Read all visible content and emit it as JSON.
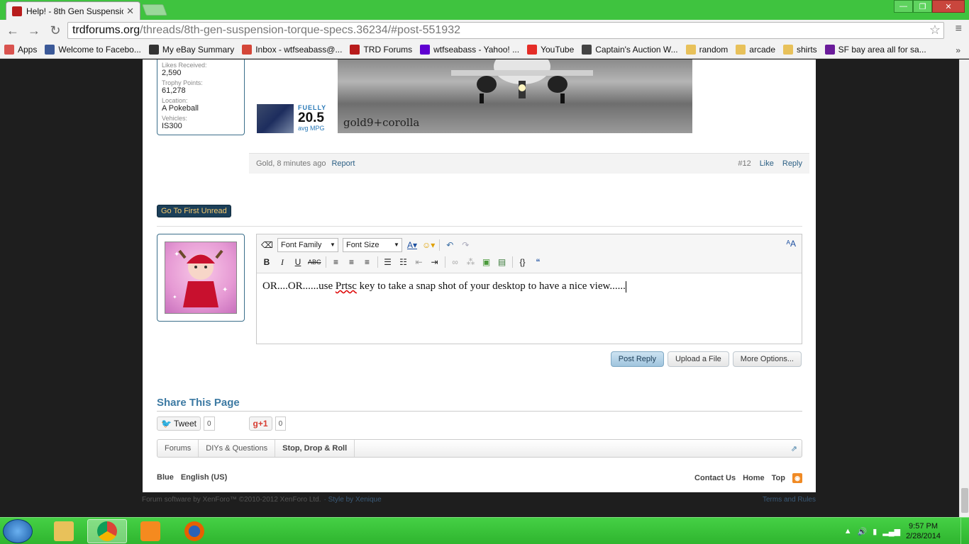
{
  "browser": {
    "tab_title": "Help! - 8th Gen Suspensio",
    "url_host": "trdforums.org",
    "url_path": "/threads/8th-gen-suspension-torque-specs.36234/#post-551932",
    "bookmarks": [
      {
        "label": "Apps",
        "color": "#d9534f"
      },
      {
        "label": "Welcome to Facebo...",
        "color": "#3b5998"
      },
      {
        "label": "My eBay Summary",
        "color": "#333333"
      },
      {
        "label": "Inbox - wtfseabass@...",
        "color": "#d44638"
      },
      {
        "label": "TRD Forums",
        "color": "#b81c1c"
      },
      {
        "label": "wtfseabass - Yahoo! ...",
        "color": "#5f01d1"
      },
      {
        "label": "YouTube",
        "color": "#e52d27"
      },
      {
        "label": "Captain's Auction W...",
        "color": "#444444"
      },
      {
        "label": "random",
        "color": "#e8c15a"
      },
      {
        "label": "arcade",
        "color": "#e8c15a"
      },
      {
        "label": "shirts",
        "color": "#e8c15a"
      },
      {
        "label": "SF bay area all for sa...",
        "color": "#6a1b9a"
      }
    ],
    "bookmarks_more": "»"
  },
  "post": {
    "stats": [
      {
        "label": "Likes Received:",
        "value": "2,590"
      },
      {
        "label": "Trophy Points:",
        "value": "61,278"
      },
      {
        "label": "Location:",
        "value": "A Pokeball"
      },
      {
        "label": "Vehicles:",
        "value": "IS300"
      }
    ],
    "fuelly": {
      "brand": "FUELLY",
      "mpg": "20.5",
      "unit": "avg MPG"
    },
    "signature_caption": "gold9+corolla",
    "author_time": "Gold, 8 minutes ago",
    "report": "Report",
    "number": "#12",
    "like": "Like",
    "reply": "Reply"
  },
  "go_first_unread": "Go To First Unread",
  "editor": {
    "font_family": "Font Family",
    "font_size": "Font Size",
    "text_before": "OR....OR......use ",
    "text_spell": "Prtsc",
    "text_after": " key to take a snap shot of your desktop to have a nice view......"
  },
  "buttons": {
    "post_reply": "Post Reply",
    "upload": "Upload a File",
    "more": "More Options..."
  },
  "share": {
    "title": "Share This Page",
    "tweet": "Tweet",
    "tweet_count": "0",
    "gplus": "+1",
    "gplus_count": "0"
  },
  "breadcrumbs": [
    "Forums",
    "DIYs & Questions",
    "Stop, Drop & Roll"
  ],
  "footer": {
    "style": "Blue",
    "language": "English (US)",
    "contact": "Contact Us",
    "home": "Home",
    "top": "Top"
  },
  "legal": {
    "software": "Forum software by XenForo™ ©2010-2012 XenForo Ltd.",
    "style_by": "· Style by Xenique",
    "terms": "Terms and Rules"
  },
  "taskbar": {
    "time": "9:57 PM",
    "date": "2/28/2014"
  }
}
